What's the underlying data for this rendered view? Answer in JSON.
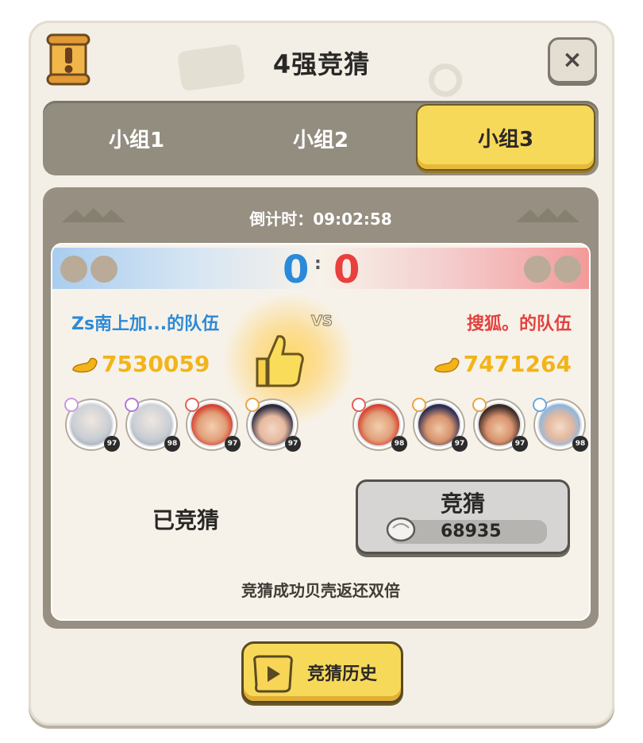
{
  "header": {
    "title": "4强竞猜",
    "close_symbol": "×",
    "icon": "scroll-icon"
  },
  "tabs": [
    {
      "label": "小组1",
      "selected": false
    },
    {
      "label": "小组2",
      "selected": false
    },
    {
      "label": "小组3",
      "selected": true
    }
  ],
  "countdown": {
    "text": "倒计时：09:02:58"
  },
  "match": {
    "score_left": "0",
    "score_right": "0",
    "vs": "VS",
    "left_team": {
      "name": "Zs南上加...的队伍",
      "power": "7530059",
      "color": "#2d8ad6",
      "heroes": [
        {
          "level": "97",
          "element": "wind"
        },
        {
          "level": "98",
          "element": "arcane"
        },
        {
          "level": "97",
          "element": "fire"
        },
        {
          "level": "97",
          "element": "fire"
        }
      ]
    },
    "right_team": {
      "name": "搜狐。的队伍",
      "power": "7471264",
      "color": "#e2423f",
      "heroes": [
        {
          "level": "98",
          "element": "fire"
        },
        {
          "level": "97",
          "element": "fire"
        },
        {
          "level": "97",
          "element": "fire"
        },
        {
          "level": "98",
          "element": "water"
        }
      ]
    }
  },
  "guess": {
    "status": "已竞猜",
    "button_label": "竞猜",
    "cost": "68935",
    "note": "竞猜成功贝壳返还双倍"
  },
  "history_button": {
    "label": "竞猜历史"
  },
  "colors": {
    "accent_yellow": "#f7d95a",
    "panel": "#f3efe6",
    "frame": "#968f82"
  }
}
